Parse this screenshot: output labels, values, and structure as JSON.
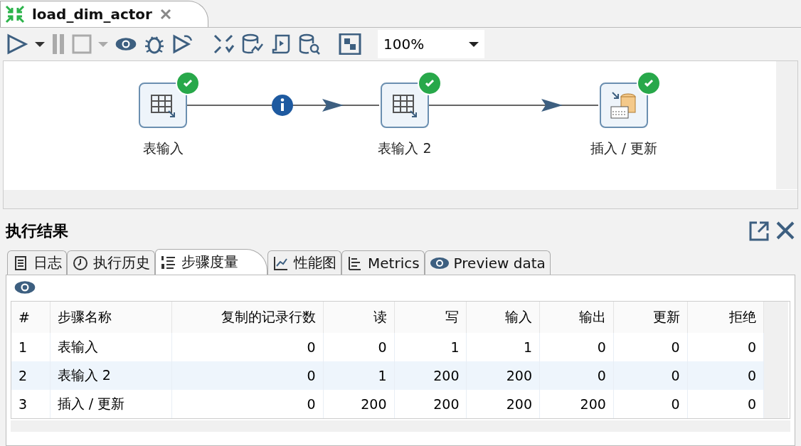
{
  "editor_tab": {
    "title": "load_dim_actor"
  },
  "toolbar": {
    "zoom": "100%"
  },
  "canvas": {
    "nodes": [
      {
        "label": "表输入",
        "kind": "table-input",
        "ok": true
      },
      {
        "label": "表输入 2",
        "kind": "table-input",
        "ok": true
      },
      {
        "label": "插入 / 更新",
        "kind": "insert-update",
        "ok": true
      }
    ],
    "hops": [
      {
        "info": true
      },
      {
        "info": false
      }
    ]
  },
  "results": {
    "title": "执行结果",
    "tabs": [
      {
        "label": "日志",
        "kind": "log",
        "selected": false
      },
      {
        "label": "执行历史",
        "kind": "history",
        "selected": false
      },
      {
        "label": "步骤度量",
        "kind": "metrics-list",
        "selected": true
      },
      {
        "label": "性能图",
        "kind": "chart",
        "selected": false
      },
      {
        "label": "Metrics",
        "kind": "metrics",
        "selected": false
      },
      {
        "label": "Preview data",
        "kind": "preview",
        "selected": false
      }
    ],
    "table": {
      "columns": [
        "#",
        "步骤名称",
        "复制的记录行数",
        "读",
        "写",
        "输入",
        "输出",
        "更新",
        "拒绝"
      ],
      "rows": [
        {
          "cells": [
            "1",
            "表输入",
            "0",
            "0",
            "1",
            "1",
            "0",
            "0",
            "0"
          ],
          "selected": false
        },
        {
          "cells": [
            "2",
            "表输入 2",
            "0",
            "1",
            "200",
            "200",
            "0",
            "0",
            "0"
          ],
          "selected": true
        },
        {
          "cells": [
            "3",
            "插入 / 更新",
            "0",
            "200",
            "200",
            "200",
            "200",
            "0",
            "0"
          ],
          "selected": false
        }
      ]
    }
  }
}
